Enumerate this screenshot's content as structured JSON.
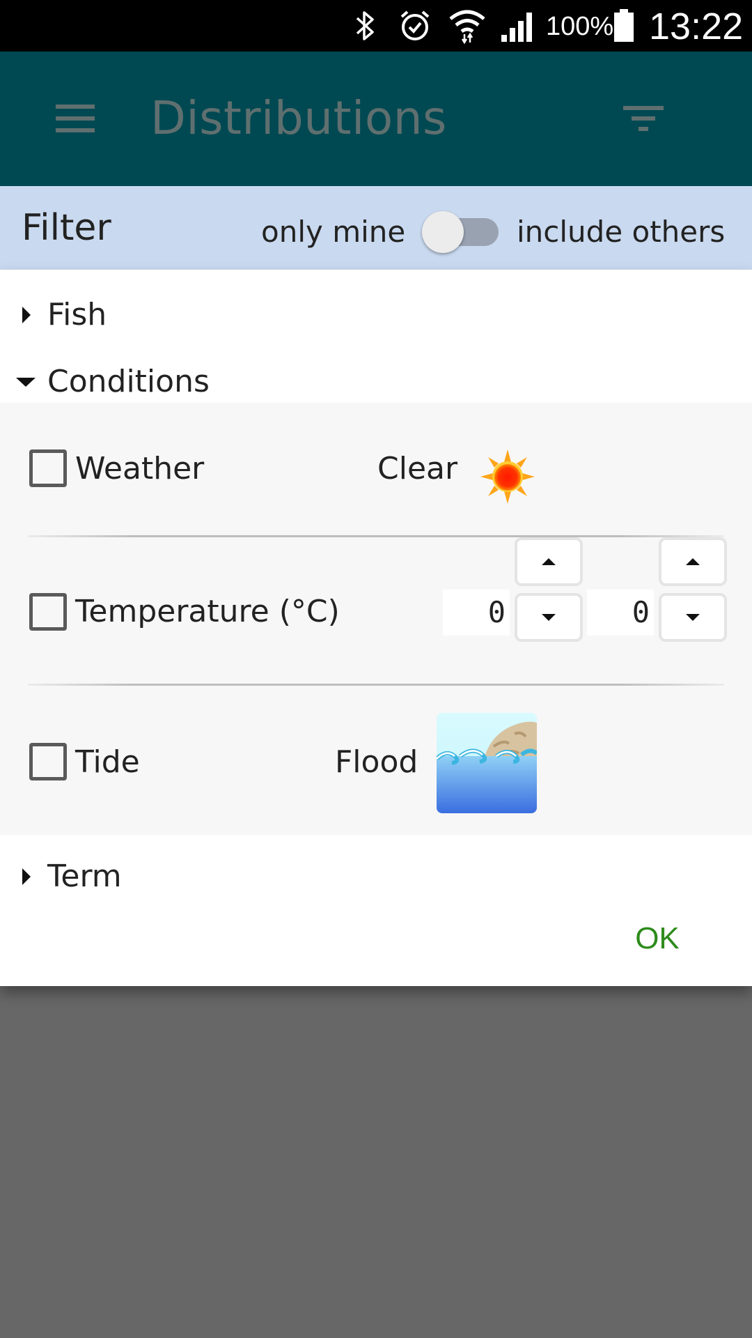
{
  "status_bar": {
    "battery_percent": "100%",
    "time": "13:22",
    "icons": [
      "bluetooth-icon",
      "alarm-icon",
      "wifi-icon",
      "signal-icon",
      "battery-icon"
    ]
  },
  "app_bar": {
    "title": "Distributions",
    "menu_icon": "hamburger-menu-icon",
    "filter_icon": "filter-icon",
    "background": "#004952"
  },
  "filter_header": {
    "title": "Filter",
    "left_option": "only mine",
    "right_option": "include others",
    "toggle_on": false,
    "background": "#c9d9ef"
  },
  "sections": {
    "fish": {
      "label": "Fish",
      "expanded": false
    },
    "conditions": {
      "label": "Conditions",
      "expanded": true
    },
    "term": {
      "label": "Term",
      "expanded": false
    }
  },
  "conditions": {
    "weather": {
      "label": "Weather",
      "checked": false,
      "value": "Clear",
      "icon": "sun-icon"
    },
    "temperature": {
      "label": "Temperature (°C)",
      "checked": false,
      "min": "0",
      "max": "0"
    },
    "tide": {
      "label": "Tide",
      "checked": false,
      "value": "Flood",
      "icon": "flood-tide-icon"
    }
  },
  "actions": {
    "ok_label": "OK",
    "ok_color": "#2e8b1c"
  }
}
